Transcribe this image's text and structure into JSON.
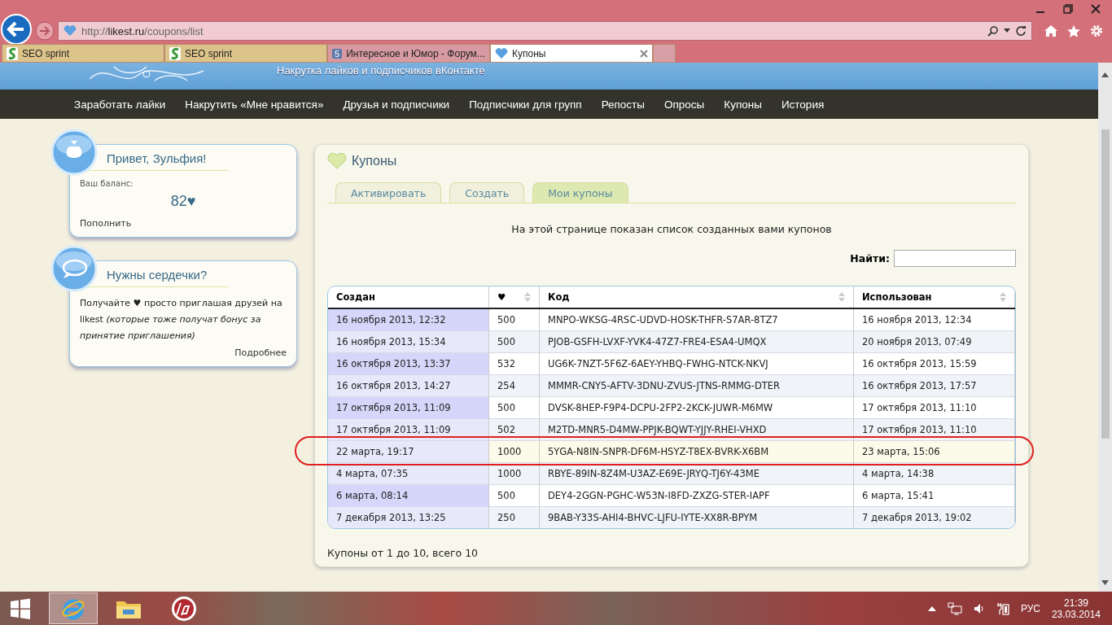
{
  "browser": {
    "address": {
      "scheme": "http://",
      "host": "likest.ru",
      "path": "/coupons/list"
    },
    "tabs": [
      {
        "kind": "seo",
        "label": "SEO sprint",
        "selected": false
      },
      {
        "kind": "seo",
        "label": "SEO sprint",
        "selected": false
      },
      {
        "kind": "forum",
        "badge": "5",
        "label": "Интересное и Юмор - Форум...",
        "selected": false
      },
      {
        "kind": "heart",
        "label": "Купоны",
        "selected": true
      }
    ]
  },
  "site": {
    "banner_text": "Накрутка лайков и подписчиков вКонтакте",
    "nav": [
      "Заработать лайки",
      "Накрутить «Мне нравится»",
      "Друзья и подписчики",
      "Подписчики для групп",
      "Репосты",
      "Опросы",
      "Купоны",
      "История"
    ]
  },
  "sidebar": {
    "greeting": {
      "title": "Привет, Зульфия!",
      "balance_label": "Ваш баланс:",
      "balance": "82♥",
      "action": "Пополнить"
    },
    "invite": {
      "title": "Нужны сердечки?",
      "text": "Получайте ♥ просто приглашая друзей на likest *(которые тоже получат бонус за принятие приглашения)*",
      "link": "Подробнее"
    }
  },
  "coupons": {
    "title": "Купоны",
    "tabs": [
      {
        "label": "Активировать",
        "selected": false
      },
      {
        "label": "Создать",
        "selected": false
      },
      {
        "label": "Мои купоны",
        "selected": true
      }
    ],
    "intro": "На этой странице показан список созданных вами купонов",
    "search": {
      "label": "Найти:"
    },
    "table": {
      "columns": [
        {
          "label": "Создан",
          "sortable": false
        },
        {
          "label": "♥",
          "sortable": true
        },
        {
          "label": "Код",
          "sortable": true
        },
        {
          "label": "Использован",
          "sortable": true
        }
      ],
      "rows": [
        {
          "cells": [
            "16 ноября 2013, 12:32",
            "500",
            "MNPO-WKSG-4RSC-UDVD-HOSK-THFR-S7AR-8TZ7",
            "16 ноября 2013, 12:34"
          ],
          "selected": false
        },
        {
          "cells": [
            "16 ноября 2013, 15:34",
            "500",
            "PJOB-GSFH-LVXF-YVK4-47Z7-FRE4-ESA4-UMQX",
            "20 ноября 2013, 07:49"
          ],
          "selected": false
        },
        {
          "cells": [
            "16 октября 2013, 13:37",
            "532",
            "UG6K-7NZT-5F6Z-6AEY-YHBQ-FWHG-NTCK-NKVJ",
            "16 октября 2013, 15:59"
          ],
          "selected": false
        },
        {
          "cells": [
            "16 октября 2013, 14:27",
            "254",
            "MMMR-CNY5-AFTV-3DNU-ZVUS-JTNS-RMMG-DTER",
            "16 октября 2013, 17:57"
          ],
          "selected": false
        },
        {
          "cells": [
            "17 октября 2013, 11:09",
            "500",
            "DVSK-8HEP-F9P4-DCPU-2FP2-2KCK-JUWR-M6MW",
            "17 октября 2013, 11:10"
          ],
          "selected": false
        },
        {
          "cells": [
            "17 октября 2013, 11:09",
            "502",
            "M2TD-MNR5-D4MW-PPJK-BQWT-YJJY-RHEI-VHXD",
            "17 октября 2013, 11:10"
          ],
          "selected": false
        },
        {
          "cells": [
            "22 марта, 19:17",
            "1000",
            "5YGA-N8IN-SNPR-DF6M-HSYZ-T8EX-BVRK-X6BM",
            "23 марта, 15:06"
          ],
          "selected": true
        },
        {
          "cells": [
            "4 марта, 07:35",
            "1000",
            "RBYE-89IN-8Z4M-U3AZ-E69E-JRYQ-TJ6Y-43ME",
            "4 марта, 14:38"
          ],
          "selected": false
        },
        {
          "cells": [
            "6 марта, 08:14",
            "500",
            "DEY4-2GGN-PGHC-W53N-I8FD-ZXZG-STER-IAPF",
            "6 марта, 15:41"
          ],
          "selected": false
        },
        {
          "cells": [
            "7 декабря 2013, 13:25",
            "250",
            "9BAB-Y33S-AHI4-BHVC-LJFU-IYTE-XX8R-BPYM",
            "7 декабря 2013, 19:02"
          ],
          "selected": false
        }
      ]
    },
    "footer": "Купоны от 1 до 10, всего 10"
  },
  "annotations": [
    {
      "kind": "outline"
    }
  ],
  "taskbar": {
    "apps": [
      {
        "kind": "ie",
        "selected": true
      },
      {
        "kind": "explorer",
        "selected": false
      },
      {
        "kind": "hp",
        "selected": false
      }
    ],
    "tray": {
      "language": "РУС",
      "time": "21:39",
      "date": "23.03.2014"
    }
  }
}
